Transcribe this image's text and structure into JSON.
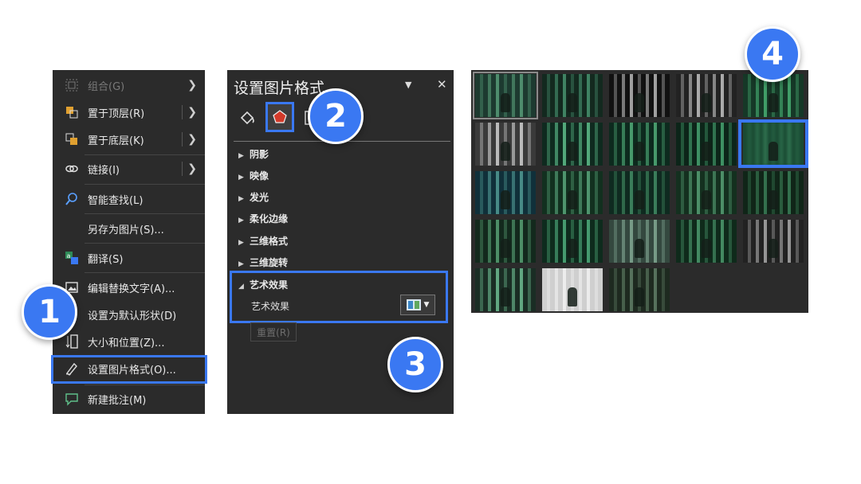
{
  "context_menu": {
    "items": [
      {
        "label": "组合(G)",
        "icon": "group-icon",
        "submenu": true,
        "disabled": true
      },
      {
        "label": "置于顶层(R)",
        "icon": "bring-to-front-icon",
        "submenu": true
      },
      {
        "label": "置于底层(K)",
        "icon": "send-to-back-icon",
        "submenu": true
      },
      {
        "label": "链接(I)",
        "icon": "link-icon",
        "submenu": true
      },
      {
        "label": "智能查找(L)",
        "icon": "smart-lookup-icon"
      },
      {
        "label": "另存为图片(S)...",
        "icon": ""
      },
      {
        "label": "翻译(S)",
        "icon": "translate-icon"
      },
      {
        "label": "编辑替换文字(A)...",
        "icon": "alt-text-icon"
      },
      {
        "label": "设置为默认形状(D)",
        "icon": "default-shape-icon"
      },
      {
        "label": "大小和位置(Z)...",
        "icon": "size-position-icon"
      },
      {
        "label": "设置图片格式(O)...",
        "icon": "format-picture-icon",
        "highlighted": true
      },
      {
        "label": "新建批注(M)",
        "icon": "new-comment-icon"
      }
    ]
  },
  "format_pane": {
    "title": "设置图片格式",
    "dropdown_glyph": "▼",
    "close_glyph": "✕",
    "sections": [
      {
        "label": "阴影",
        "expander": "▶"
      },
      {
        "label": "映像",
        "expander": "▶"
      },
      {
        "label": "发光",
        "expander": "▶"
      },
      {
        "label": "柔化边缘",
        "expander": "▶"
      },
      {
        "label": "三维格式",
        "expander": "▶"
      },
      {
        "label": "三维旋转",
        "expander": "▶"
      }
    ],
    "artistic": {
      "label": "艺术效果",
      "expander": "◢",
      "sub_label": "艺术效果"
    },
    "reset_label": "重置(R)"
  },
  "gallery": {
    "rows": 5,
    "cols": 5,
    "count": 23,
    "highlighted_index": 9
  },
  "badges": [
    "1",
    "2",
    "3",
    "4"
  ],
  "colors": {
    "accent": "#3a78f2",
    "panel": "#2b2b2b",
    "text": "#e8e8e8"
  }
}
